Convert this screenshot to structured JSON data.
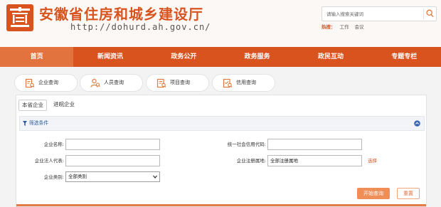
{
  "header": {
    "title": "安徽省住房和城乡建设厅",
    "url": "http://dohurd.ah.gov.cn/",
    "search_placeholder": "请输入搜索关键词",
    "hot_label": "热搜：",
    "hot_words": [
      "工作",
      "会议"
    ]
  },
  "nav": {
    "items": [
      "首页",
      "新闻资讯",
      "政务公开",
      "政务服务",
      "政民互动",
      "专题专栏"
    ],
    "active_index": 0
  },
  "categories": [
    "企业查询",
    "人员查询",
    "项目查询",
    "信用查询"
  ],
  "panel": {
    "subtabs": [
      "本省企业",
      "进皖企业"
    ],
    "active_subtab": 0,
    "filter_title": "筛选条件",
    "fields": {
      "company_name_label": "企业名称:",
      "credit_code_label": "统一社会信用代码:",
      "legal_rep_label": "企业法人代表:",
      "reg_place_label": "企业注册属地:",
      "reg_place_value": "全部注册属地",
      "choose_label": "选择",
      "company_type_label": "企业类别:",
      "company_type_value": "全部类别"
    },
    "search_button": "开始查询",
    "reset_button": "重置"
  },
  "colors": {
    "brand": "#d9531e",
    "nav_active": "#e2733f",
    "primary_button": "#f08e58",
    "filter_text": "#2a5a9c"
  }
}
